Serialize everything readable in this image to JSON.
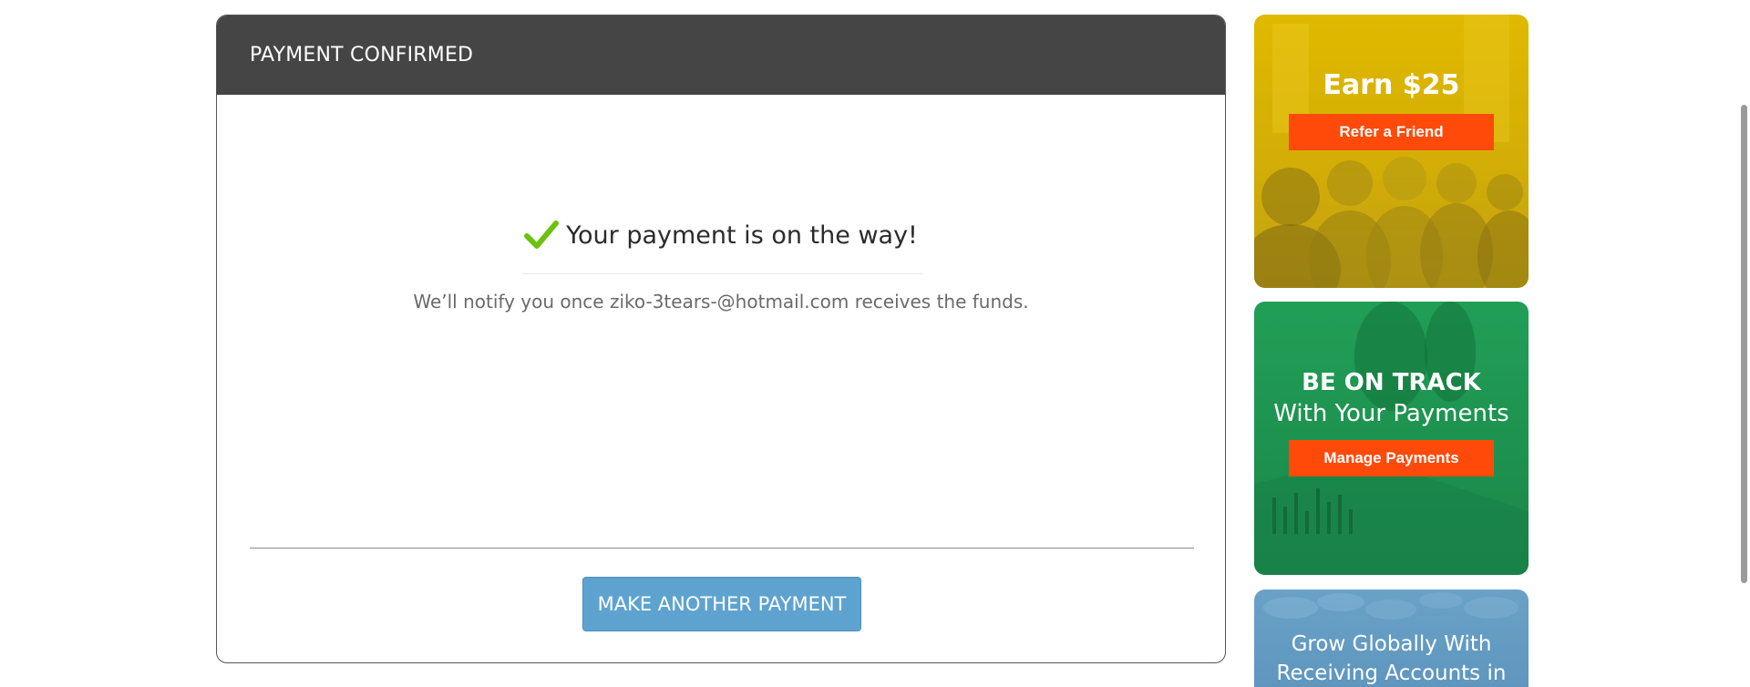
{
  "confirmation": {
    "header_title": "PAYMENT CONFIRMED",
    "headline": "Your payment is on the way!",
    "notify_text": "We’ll notify you once ziko-3tears-@hotmail.com receives the funds.",
    "button_label": "MAKE ANOTHER PAYMENT",
    "check_color": "#6cc20c",
    "header_color": "#454545",
    "button_color": "#5ea3cf"
  },
  "promos": {
    "earn": {
      "title": "Earn $25",
      "cta": "Refer a Friend",
      "bg_color": "#e3bb00"
    },
    "track": {
      "title": "BE ON TRACK",
      "subtitle": "With Your Payments",
      "cta": "Manage Payments",
      "bg_color": "#22a35a"
    },
    "grow": {
      "text": "Grow Globally With Receiving Accounts in",
      "bg_color": "#6aa1c7"
    },
    "cta_color": "#ff4a0a"
  }
}
